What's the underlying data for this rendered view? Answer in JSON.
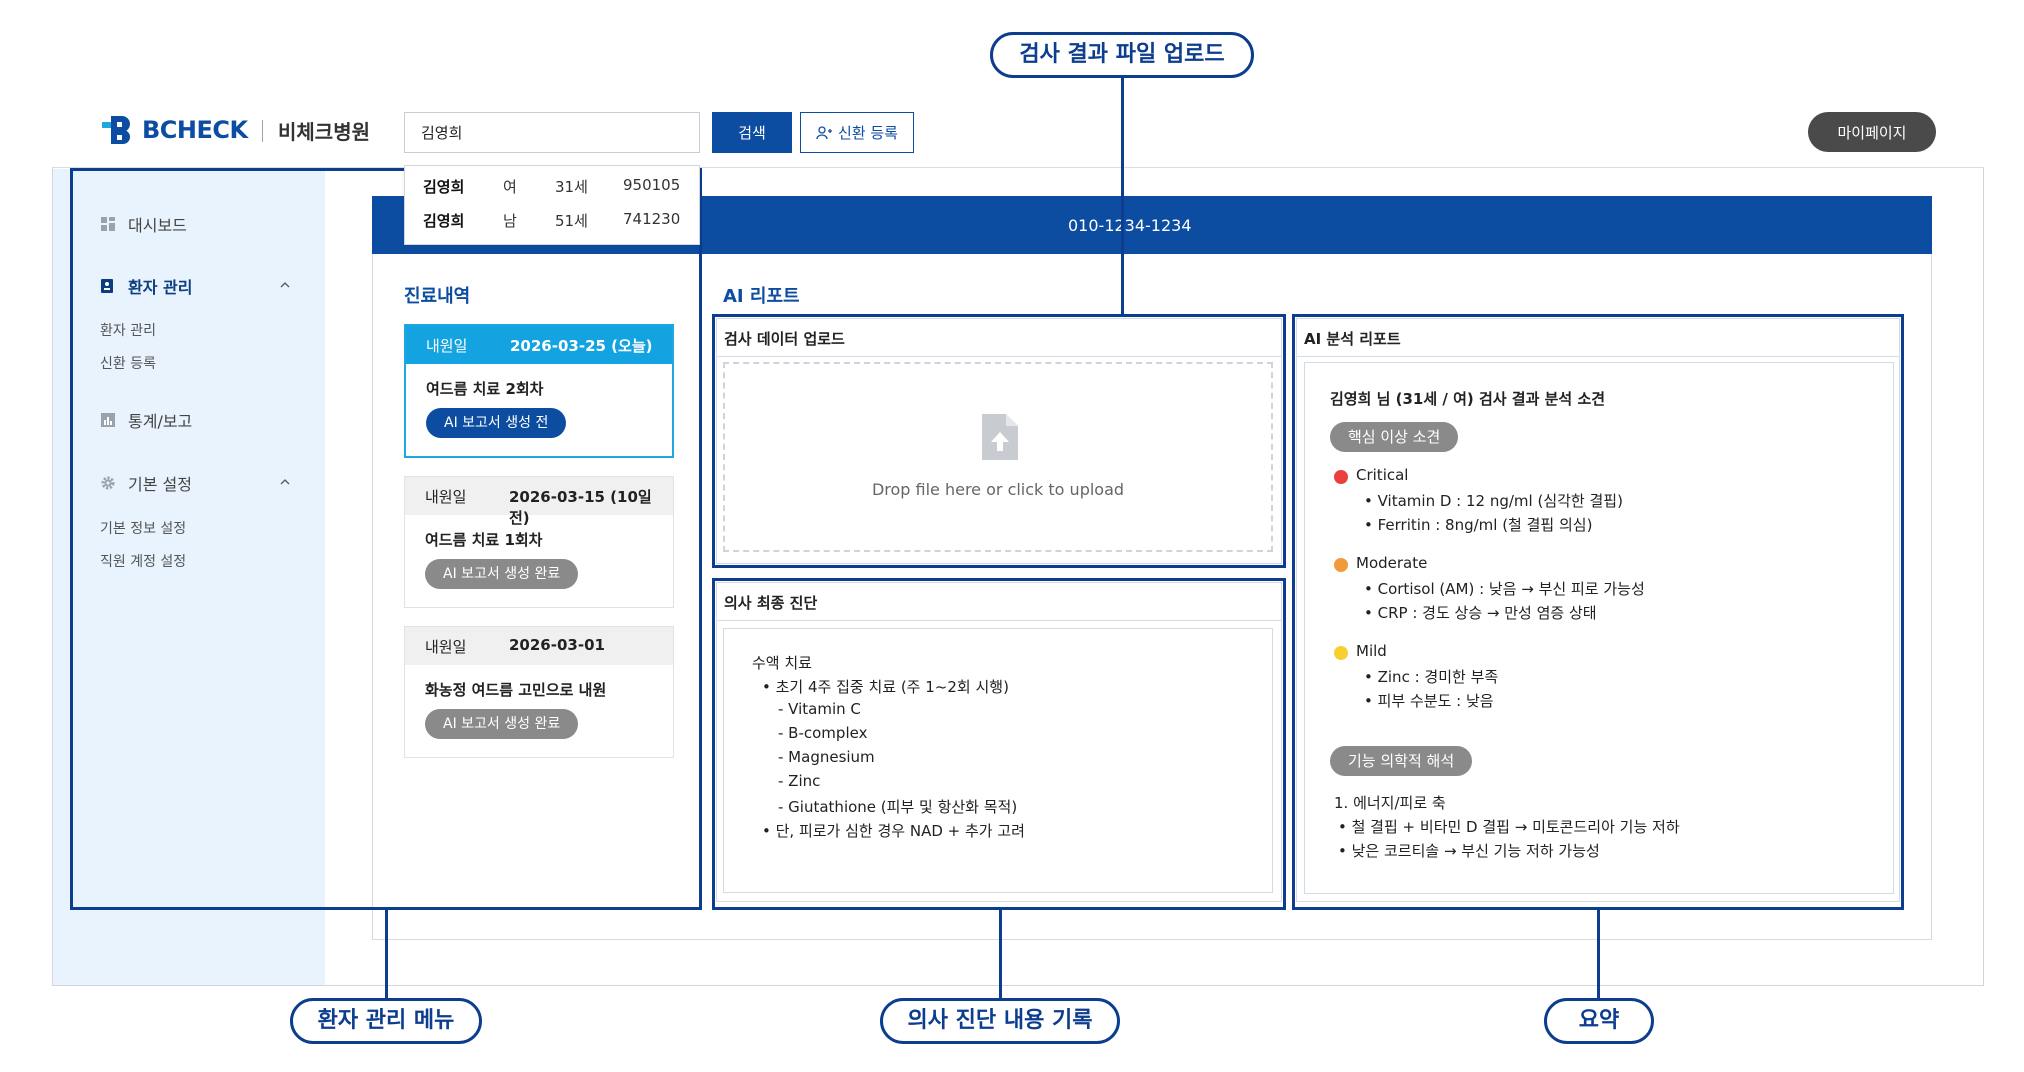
{
  "header": {
    "logo_text": "BCHECK",
    "hospital_name": "비체크병원",
    "search_value": "김영희",
    "search_button": "검색",
    "new_patient_button": "신환 등록",
    "mypage_button": "마이페이지"
  },
  "dropdown": [
    {
      "name": "김영희",
      "sex": "여",
      "age": "31세",
      "birth": "950105"
    },
    {
      "name": "김영희",
      "sex": "남",
      "age": "51세",
      "birth": "741230"
    }
  ],
  "patient_bar": {
    "phone": "010-1234-1234"
  },
  "sidebar": {
    "dashboard": "대시보드",
    "patient_mgmt": "환자 관리",
    "patient_sub": [
      "환자 관리",
      "신환 등록"
    ],
    "stats": "통계/보고",
    "settings": "기본 설정",
    "settings_sub": [
      "기본 정보 설정",
      "직원 계정 설정"
    ]
  },
  "history": {
    "title": "진료내역",
    "visits": [
      {
        "label": "내원일",
        "date": "2026-03-25 (오늘)",
        "title": "여드름 치료 2회차",
        "badge": "AI 보고서 생성 전"
      },
      {
        "label": "내원일",
        "date": "2026-03-15 (10일 전)",
        "title": "여드름 치료 1회차",
        "badge": "AI 보고서 생성 완료"
      },
      {
        "label": "내원일",
        "date": "2026-03-01",
        "title": "화농정 여드름 고민으로 내원",
        "badge": "AI 보고서 생성 완료"
      }
    ]
  },
  "ai_report": {
    "title": "AI 리포트",
    "upload_panel_title": "검사 데이터 업로드",
    "upload_text": "Drop file here or click to upload",
    "diagnosis_title": "의사 최종 진단",
    "diagnosis_lines": [
      "수액 치료",
      "•  초기 4주 집중 치료 (주 1~2회 시행)",
      "- Vitamin C",
      "- B-complex",
      "- Magnesium",
      "- Zinc",
      "- Giutathione (피부 및 항산화 목적)",
      "•  단, 피로가 심한 경우 NAD + 추가 고려"
    ],
    "analysis_title": "AI 분석 리포트",
    "analysis_heading": "김영희 님 (31세 / 여) 검사 결과 분석 소견",
    "core_findings_pill": "핵심 이상 소견",
    "critical_label": "Critical",
    "critical_items": [
      "•  Vitamin D : 12 ng/ml (심각한 결핍)",
      "•  Ferritin : 8ng/ml (철 결핍 의심)"
    ],
    "moderate_label": "Moderate",
    "moderate_items": [
      "•  Cortisol (AM) : 낮음 → 부신 피로 가능성",
      "•  CRP : 경도 상승 → 만성 염증 상태"
    ],
    "mild_label": "Mild",
    "mild_items": [
      "•  Zinc : 경미한 부족",
      "•  피부 수분도 : 낮음"
    ],
    "functional_pill": "기능 의학적 해석",
    "functional_lines": [
      "1. 에너지/피로 축",
      "•  철 결핍 +  비타민 D 결핍 → 미토콘드리아 기능 저하",
      "•  낮은 코르티솔 → 부신 기능 저하 가능성"
    ]
  },
  "annotations": {
    "upload": "검사 결과 파일 업로드",
    "menu": "환자 관리 메뉴",
    "diagnosis": "의사 진단 내용 기록",
    "summary": "요약"
  },
  "colors": {
    "brand": "#0c4da2",
    "selected": "#14a3e1",
    "critical": "#e8413c",
    "moderate": "#f29a3a",
    "mild": "#f6d02f"
  }
}
